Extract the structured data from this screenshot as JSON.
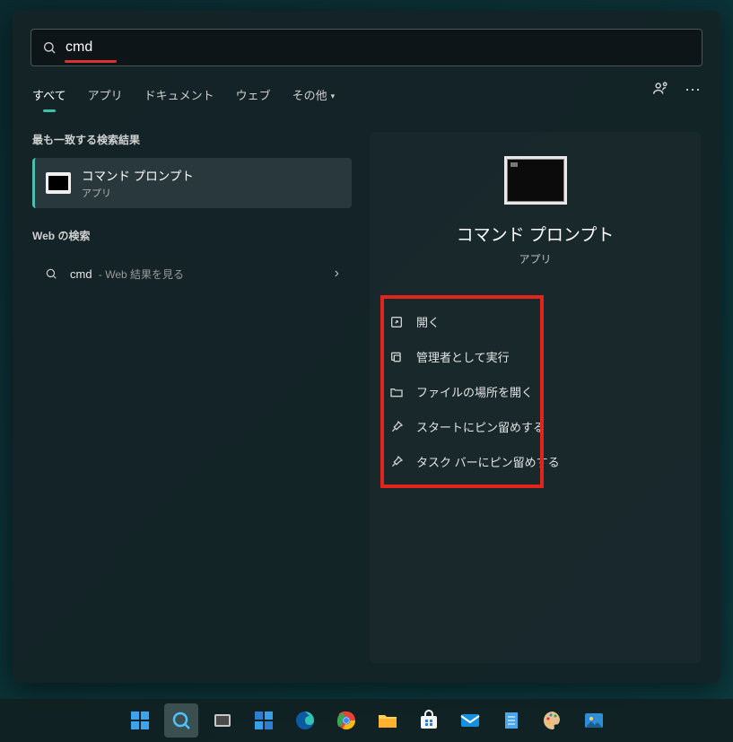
{
  "search": {
    "value": "cmd",
    "placeholder": ""
  },
  "tabs": {
    "all": "すべて",
    "apps": "アプリ",
    "documents": "ドキュメント",
    "web": "ウェブ",
    "more": "その他"
  },
  "sections": {
    "best_match": "最も一致する検索結果",
    "web_search": "Web の検索"
  },
  "best_match": {
    "title": "コマンド プロンプト",
    "subtitle": "アプリ"
  },
  "web_item": {
    "term": "cmd",
    "suffix": " - Web 結果を見る"
  },
  "preview": {
    "title": "コマンド プロンプト",
    "subtitle": "アプリ"
  },
  "actions": {
    "open": "開く",
    "run_admin": "管理者として実行",
    "open_location": "ファイルの場所を開く",
    "pin_start": "スタートにピン留めする",
    "pin_taskbar": "タスク バーにピン留めする"
  },
  "icons": {
    "start": "start-icon",
    "search": "search-icon",
    "taskview": "taskview-icon",
    "widgets": "widgets-icon",
    "edge": "edge-icon",
    "chrome": "chrome-icon",
    "explorer": "explorer-icon",
    "store": "store-icon",
    "mail": "mail-icon",
    "notepad": "notepad-icon",
    "paint": "paint-icon",
    "photos": "photos-icon"
  }
}
